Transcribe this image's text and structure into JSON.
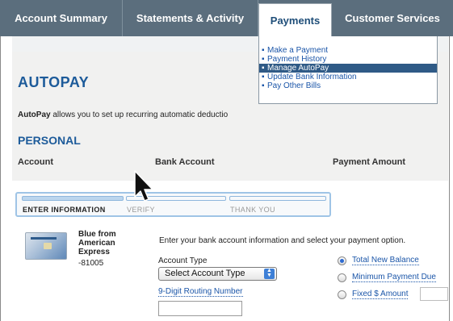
{
  "nav": {
    "tabs": [
      {
        "label": "Account Summary"
      },
      {
        "label": "Statements & Activity"
      },
      {
        "label": "Payments"
      },
      {
        "label": "Customer Services"
      }
    ]
  },
  "menu": {
    "items": [
      {
        "label": "Make a Payment"
      },
      {
        "label": "Payment History"
      },
      {
        "label": "Manage AutoPay"
      },
      {
        "label": "Update Bank Information"
      },
      {
        "label": "Pay Other Bills"
      }
    ]
  },
  "page": {
    "title": "AUTOPAY",
    "desc_bold": "AutoPay",
    "desc_rest": "allows you to set up recurring automatic deductio",
    "section": "PERSONAL",
    "columns": [
      "Account",
      "Bank Account",
      "Payment Amount"
    ]
  },
  "steps": [
    "ENTER INFORMATION",
    "VERIFY",
    "THANK YOU"
  ],
  "card": {
    "name_line1": "Blue from",
    "name_line2": "American",
    "name_line3": "Express",
    "number": "-81005"
  },
  "form": {
    "instruction": "Enter your bank account information and select your payment option.",
    "account_type_label": "Account Type",
    "account_type_value": "Select Account Type",
    "routing_label": "9-Digit Routing Number",
    "options": [
      {
        "label": "Total New Balance",
        "selected": true
      },
      {
        "label": "Minimum Payment Due",
        "selected": false
      },
      {
        "label": "Fixed $ Amount",
        "selected": false
      }
    ]
  },
  "colors": {
    "nav_bg": "#5b6e7d",
    "accent": "#1d5b9a",
    "menu_highlight": "#2f5a86",
    "link": "#1a55a8"
  }
}
